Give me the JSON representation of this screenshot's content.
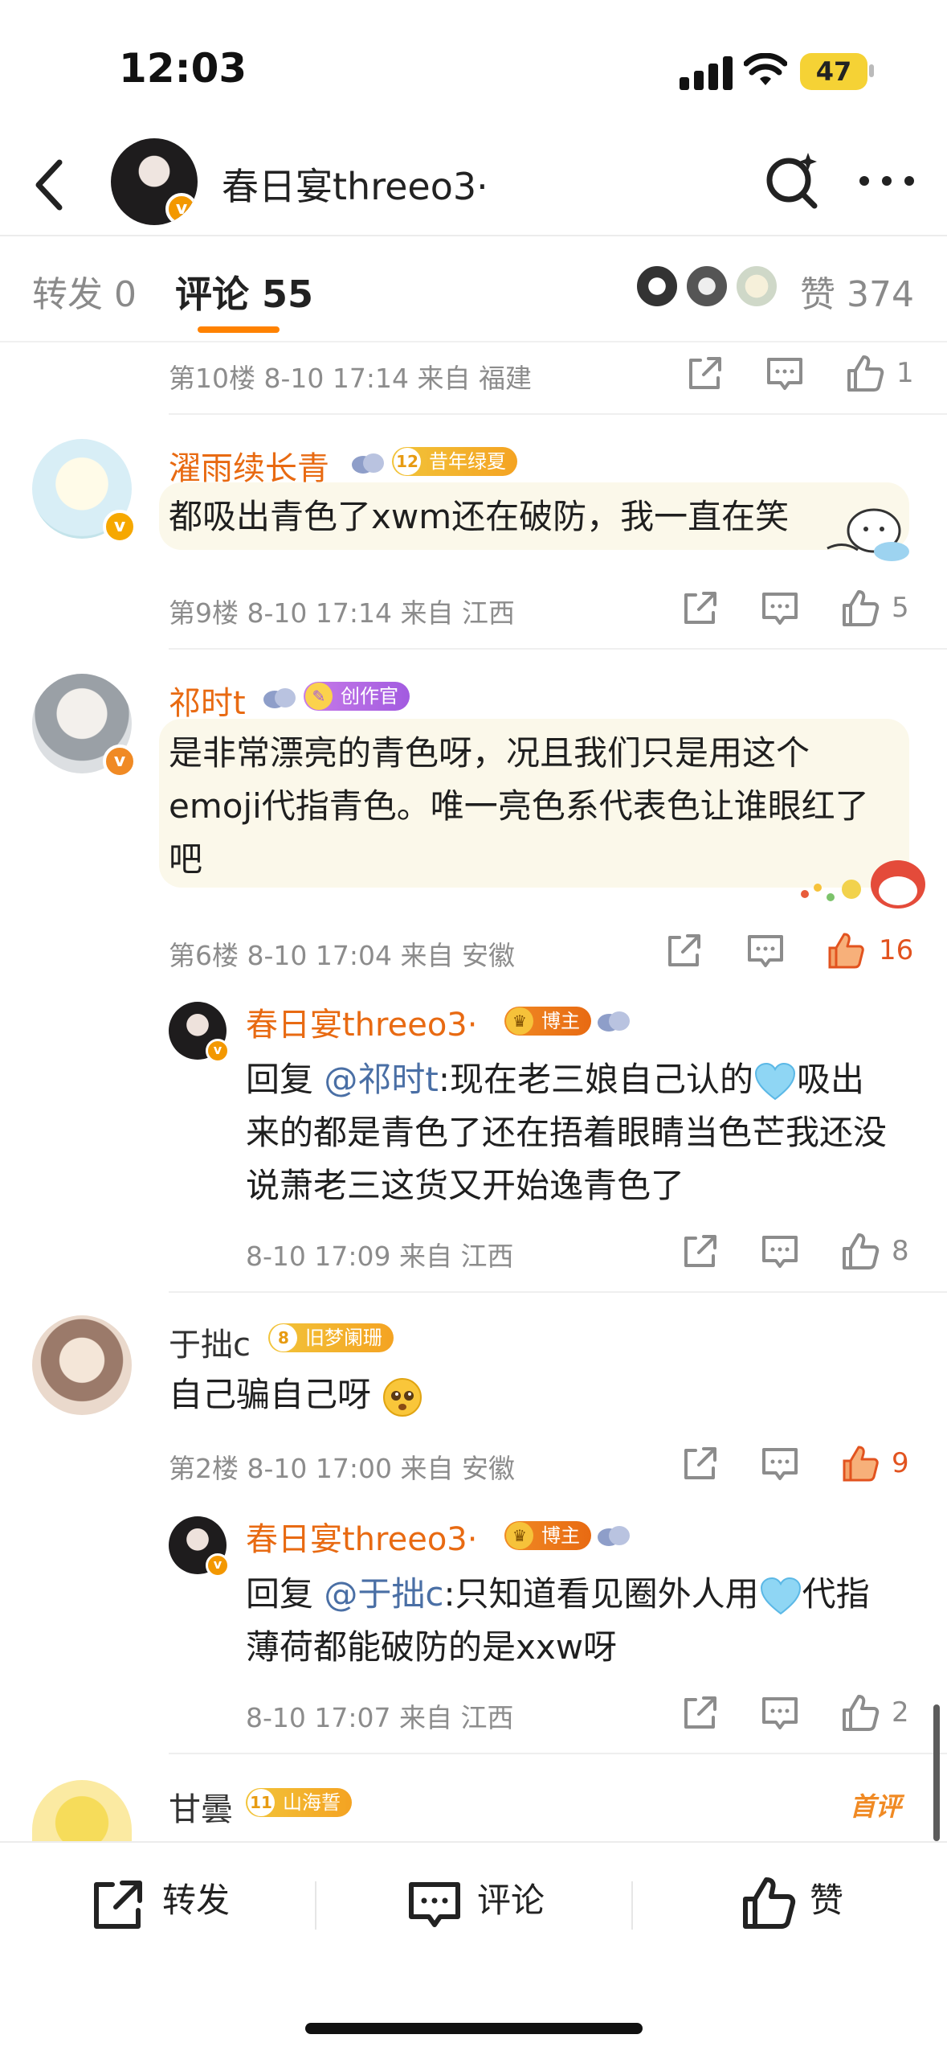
{
  "status_bar": {
    "time": "12:03",
    "battery": "47"
  },
  "header": {
    "title": "春日宴threeo3·"
  },
  "tabs": {
    "repost": "转发 0",
    "comment": "评论 55",
    "likes": "赞 374"
  },
  "comments": [
    {
      "floor_meta": "第10楼  8-10 17:14  来自 福建",
      "like_count": "1"
    },
    {
      "user": "濯雨续长青",
      "badge_num": "12",
      "badge_text": "昔年绿夏",
      "text": "都吸出青色了xwm还在破防，我一直在笑",
      "meta": "第9楼  8-10 17:14  来自 江西",
      "like_count": "5"
    },
    {
      "user": "祁时t",
      "badge_text": "创作官",
      "text": "是非常漂亮的青色呀，况且我们只是用这个emoji代指青色。唯一亮色系代表色让谁眼红了吧",
      "meta": "第6楼  8-10 17:04  来自 安徽",
      "like_count": "16"
    },
    {
      "user": "春日宴threeo3·",
      "badge_text": "博主",
      "text_prefix": "回复 ",
      "mention": "@祁时t",
      "text_a": ":现在老三娘自己认的",
      "text_b": "吸出来的都是青色了还在捂着眼睛当色芒我还没说萧老三这货又开始逸青色了",
      "meta": "8-10 17:09  来自 江西",
      "like_count": "8"
    },
    {
      "user": "于拙c",
      "badge_num": "8",
      "badge_text": "旧梦阑珊",
      "text": "自己骗自己呀",
      "meta": "第2楼  8-10 17:00  来自 安徽",
      "like_count": "9"
    },
    {
      "user": "春日宴threeo3·",
      "badge_text": "博主",
      "text_prefix": "回复 ",
      "mention": "@于拙c",
      "text_a": ":只知道看见圈外人用",
      "text_b": "代指薄荷都能破防的是xxw呀",
      "meta": "8-10 17:07  来自 江西",
      "like_count": "2"
    },
    {
      "user": "甘曇",
      "badge_num": "11",
      "badge_text": "山海誓",
      "tag": "首评"
    }
  ],
  "bottom_bar": {
    "repost": "转发",
    "comment": "评论",
    "like": "赞"
  },
  "colors": {
    "accent": "#ff8200",
    "username": "#e86a12",
    "hot_like": "#e2531f",
    "mention": "#4a6fa5",
    "heart": "#8fd6f4"
  }
}
